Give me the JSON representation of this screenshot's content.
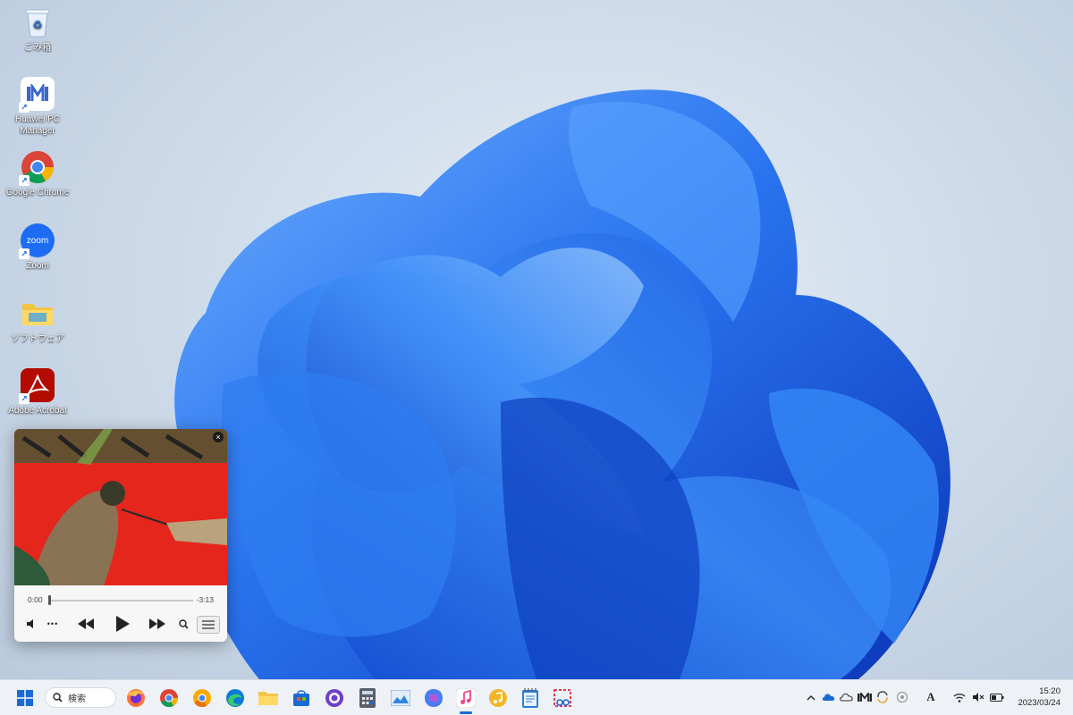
{
  "desktop": {
    "icons": [
      {
        "label": "ごみ箱",
        "icon": "recycle-bin-icon"
      },
      {
        "label": "Huawei PC Manager",
        "icon": "huawei-pc-manager-icon"
      },
      {
        "label": "Google Chrome",
        "icon": "chrome-icon"
      },
      {
        "label": "Zoom",
        "icon": "zoom-icon",
        "badge": "zoom"
      },
      {
        "label": "ソフトウェア",
        "icon": "folder-icon"
      },
      {
        "label": "Adobe Acrobat",
        "icon": "acrobat-icon"
      }
    ]
  },
  "player": {
    "time_elapsed": "0:00",
    "time_remaining": "-3:13",
    "progress": 0.0,
    "close_label": "×",
    "controls": [
      "volume-icon",
      "more-icon",
      "rewind-icon",
      "play-icon",
      "fast-forward-icon",
      "search-icon",
      "queue-list-icon"
    ],
    "more_label": "•••"
  },
  "taskbar": {
    "search_label": "検索",
    "apps": [
      "start-icon",
      "firefox-icon",
      "chrome-icon",
      "chrome-canary-icon",
      "edge-icon",
      "file-explorer-icon",
      "store-icon",
      "github-desktop-icon",
      "calculator-icon",
      "photos-icon",
      "copilot-icon",
      "itunes-icon",
      "music-app-icon",
      "notepad-icon",
      "snipping-tool-icon"
    ],
    "active_app": "itunes-icon",
    "tray": [
      "chevron-up-icon",
      "onedrive-icon",
      "cloud-icon",
      "huawei-tray-icon",
      "sync-icon",
      "copilot-tray-icon",
      "font-a-icon",
      "wifi-icon",
      "mute-icon",
      "battery-icon"
    ],
    "font_tray_label": "A",
    "clock_time": "15:20",
    "clock_date": "2023/03/24"
  },
  "colors": {
    "accent": "#1a6ad6",
    "bloom_dark": "#0a3fc4",
    "bloom_light": "#3d8cf5",
    "album_red": "#e5261d"
  }
}
